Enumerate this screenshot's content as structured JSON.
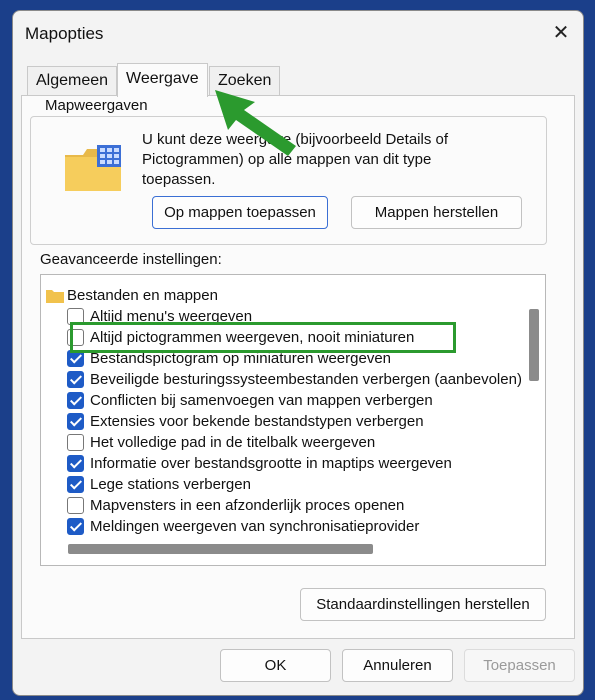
{
  "window": {
    "title": "Mapopties"
  },
  "tabs": [
    {
      "label": "Algemeen"
    },
    {
      "label": "Weergave"
    },
    {
      "label": "Zoeken"
    }
  ],
  "folder_views": {
    "group_label": "Mapweergaven",
    "description": "U kunt deze weergave (bijvoorbeeld Details of Pictogrammen) op alle mappen van dit type toepassen.",
    "apply_button": "Op mappen toepassen",
    "reset_button": "Mappen herstellen"
  },
  "advanced": {
    "label": "Geavanceerde instellingen:",
    "root": "Bestanden en mappen",
    "items": [
      {
        "label": "Altijd menu's weergeven",
        "checked": false
      },
      {
        "label": "Altijd pictogrammen weergeven, nooit miniaturen",
        "checked": false
      },
      {
        "label": "Bestandspictogram op miniaturen weergeven",
        "checked": true
      },
      {
        "label": "Beveiligde besturingssysteembestanden verbergen (aanbevolen)",
        "checked": true
      },
      {
        "label": "Conflicten bij samenvoegen van mappen verbergen",
        "checked": true
      },
      {
        "label": "Extensies voor bekende bestandstypen verbergen",
        "checked": true
      },
      {
        "label": "Het volledige pad in de titelbalk weergeven",
        "checked": false
      },
      {
        "label": "Informatie over bestandsgrootte in maptips weergeven",
        "checked": true
      },
      {
        "label": "Lege stations verbergen",
        "checked": true
      },
      {
        "label": "Mapvensters in een afzonderlijk proces openen",
        "checked": false
      },
      {
        "label": "Meldingen weergeven van synchronisatieprovider",
        "checked": true
      }
    ],
    "restore_defaults_button": "Standaardinstellingen herstellen"
  },
  "footer": {
    "ok": "OK",
    "cancel": "Annuleren",
    "apply": "Toepassen"
  },
  "colors": {
    "annotation_green": "#2b9a2e",
    "checkbox_blue": "#1e5bc6"
  }
}
